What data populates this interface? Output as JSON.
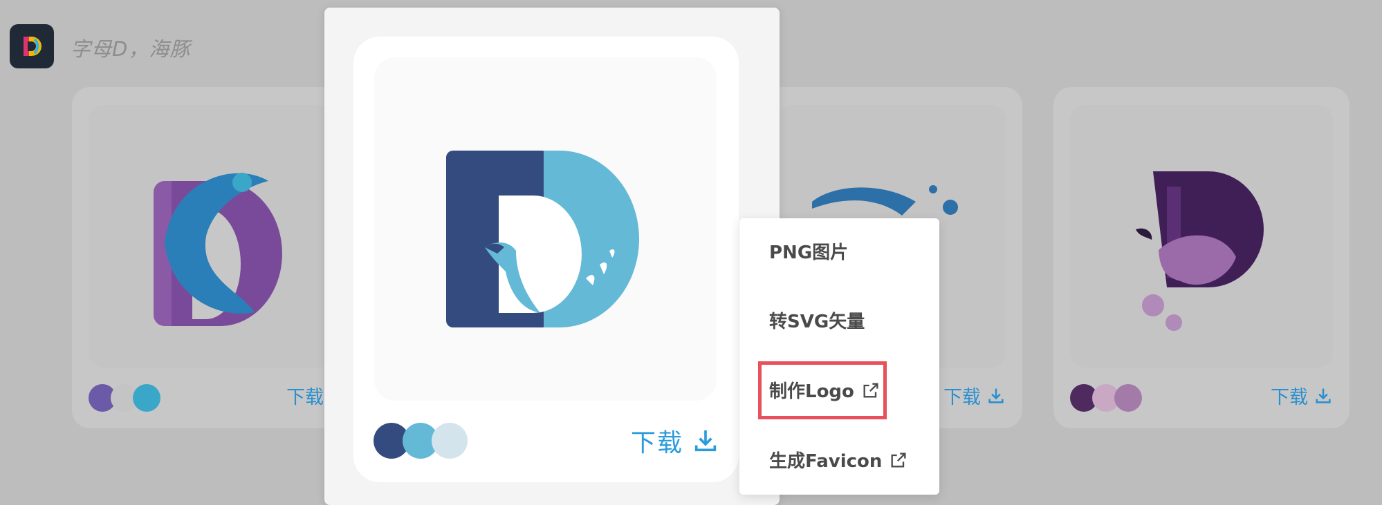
{
  "header": {
    "search_hint": "字母D，海豚"
  },
  "cards": [
    {
      "download_label": "下载",
      "colors": [
        "#6a5aa8",
        "#c4c4c4",
        "#3aa7c9"
      ]
    },
    {
      "download_label": "下载",
      "colors": []
    },
    {
      "download_label": "下载",
      "colors": [
        "#4e2a5e",
        "#c9a8c4",
        "#a47ba8"
      ]
    }
  ],
  "popover_card": {
    "download_label": "下载",
    "colors": [
      "#344b7f",
      "#64b9d6",
      "#d4e4ec"
    ]
  },
  "menu": {
    "items": [
      {
        "label": "PNG图片",
        "external": false
      },
      {
        "label": "转SVG矢量",
        "external": false
      },
      {
        "label": "制作Logo",
        "external": true
      },
      {
        "label": "生成Favicon",
        "external": true
      }
    ]
  },
  "accent_color": "#2a9cdc",
  "highlight_color": "#e8505b"
}
